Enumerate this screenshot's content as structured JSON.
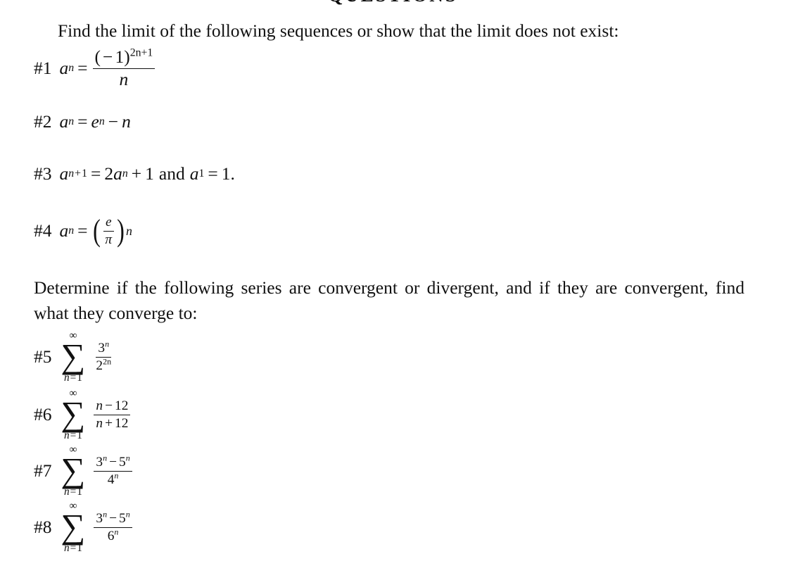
{
  "document": {
    "title": "QUESTIONS",
    "background_color": "#ffffff",
    "text_color": "#111111"
  },
  "sections": [
    {
      "instruction": "Find the limit of the following sequences or show that the limit does not exist:",
      "problems": [
        {
          "tag": "#1",
          "expression": "a_n = (-1)^(2n+1) / n"
        },
        {
          "tag": "#2",
          "expression": "a_n = e^n - n"
        },
        {
          "tag": "#3",
          "expression": "a_{n+1} = 2a_n + 1 and a_1 = 1."
        },
        {
          "tag": "#4",
          "expression": "a_n = (e/pi)^n"
        }
      ]
    },
    {
      "instruction": "Determine if the following series are convergent or divergent, and if they are convergent, find what they converge to:",
      "problems": [
        {
          "tag": "#5",
          "expression": "sum_{n=1}^{infinity} 3^n / 2^{2n}"
        },
        {
          "tag": "#6",
          "expression": "sum_{n=1}^{infinity} (n-12) / (n+12)"
        },
        {
          "tag": "#7",
          "expression": "sum_{n=1}^{infinity} (3^n - 5^n) / 4^n"
        },
        {
          "tag": "#8",
          "expression": "sum_{n=1}^{infinity} (3^n - 5^n) / 6^n"
        }
      ]
    }
  ],
  "symbols": {
    "sum": "∑",
    "infinity": "∞",
    "equals": "=",
    "plus": "+",
    "minus": "−",
    "pi": "π",
    "e": "e",
    "n": "n",
    "a": "a",
    "one": "1",
    "two": "2",
    "three": "3",
    "four": "4",
    "five": "5",
    "six": "6",
    "twelve": "12",
    "lparen": "(",
    "rparen": ")",
    "period": ".",
    "and": "and",
    "n_equals_1_sub": "n",
    "two_n": "2n",
    "sup_2n_plus_1": "2n+1"
  },
  "layout": {
    "tag1": "#1",
    "tag2": "#2",
    "tag3": "#3",
    "tag4": "#4",
    "tag5": "#5",
    "tag6": "#6",
    "tag7": "#7",
    "tag8": "#8"
  }
}
